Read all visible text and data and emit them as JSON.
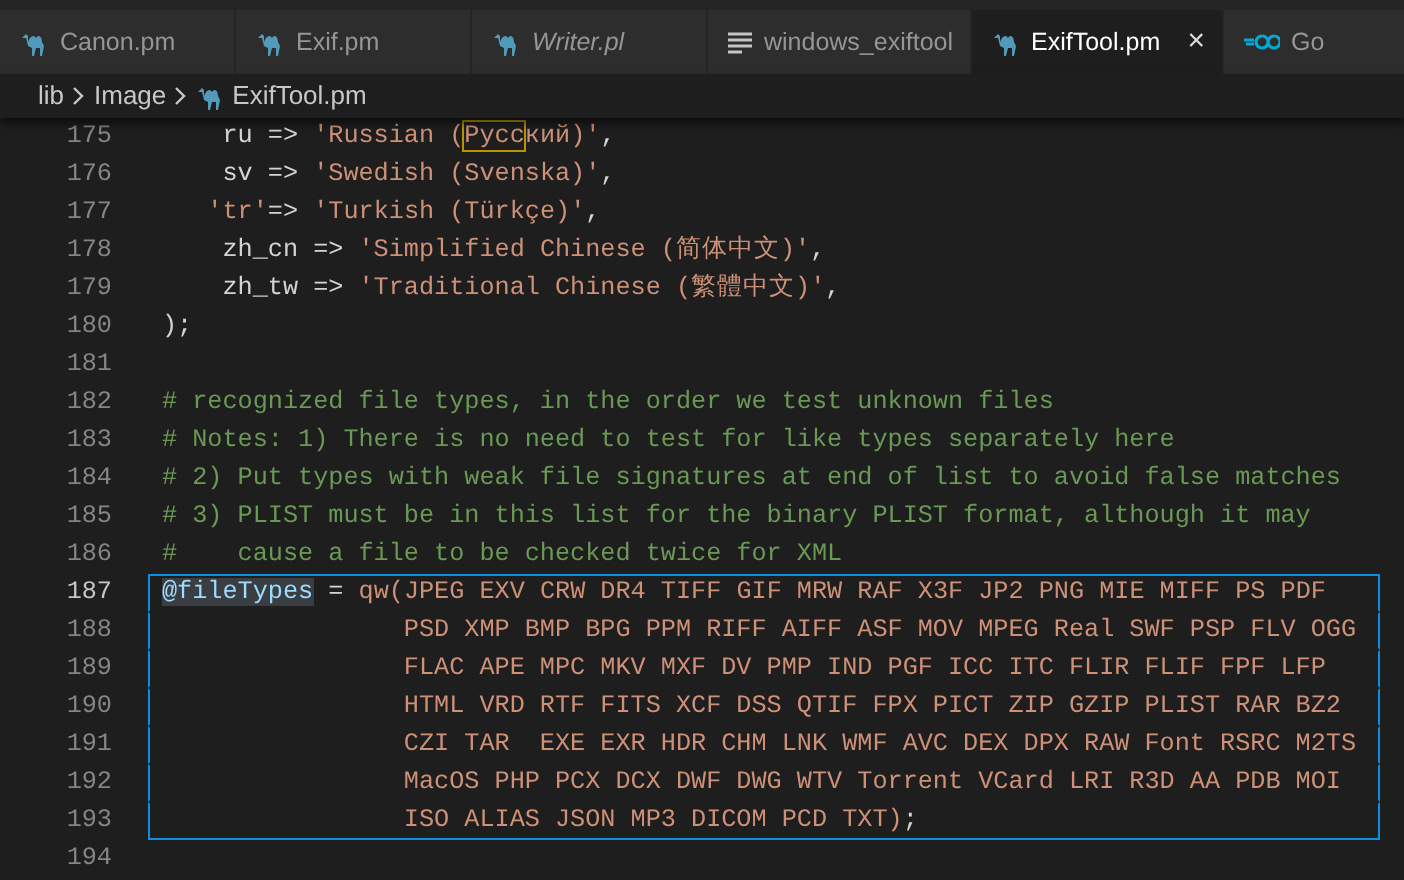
{
  "tabs": [
    {
      "label": "Canon.pm",
      "kind": "perl",
      "selected": false,
      "preview": false
    },
    {
      "label": "Exif.pm",
      "kind": "perl",
      "selected": false,
      "preview": false
    },
    {
      "label": "Writer.pl",
      "kind": "perl",
      "selected": false,
      "preview": true
    },
    {
      "label": "windows_exiftool",
      "kind": "text",
      "selected": false,
      "preview": false
    },
    {
      "label": "ExifTool.pm",
      "kind": "perl",
      "selected": true,
      "preview": false,
      "close": "×"
    },
    {
      "label": "Go",
      "kind": "go",
      "selected": false,
      "preview": false
    }
  ],
  "breadcrumb": [
    {
      "label": "lib",
      "kind": "folder"
    },
    {
      "label": "Image",
      "kind": "folder"
    },
    {
      "label": "ExifTool.pm",
      "kind": "perl"
    }
  ],
  "lines": [
    {
      "number": "175",
      "current": false,
      "boxed": false,
      "tokens": [
        {
          "kind": "plain",
          "text": "    ru => "
        },
        {
          "kind": "string",
          "text": "'Russian ("
        },
        {
          "kind": "flagged",
          "text": "Русс"
        },
        {
          "kind": "string",
          "text": "кий)'"
        },
        {
          "kind": "plain",
          "text": ","
        }
      ]
    },
    {
      "number": "176",
      "current": false,
      "boxed": false,
      "tokens": [
        {
          "kind": "plain",
          "text": "    sv => "
        },
        {
          "kind": "string",
          "text": "'Swedish (Svenska)'"
        },
        {
          "kind": "plain",
          "text": ","
        }
      ]
    },
    {
      "number": "177",
      "current": false,
      "boxed": false,
      "tokens": [
        {
          "kind": "string",
          "text": "   'tr'"
        },
        {
          "kind": "plain",
          "text": "=> "
        },
        {
          "kind": "string",
          "text": "'Turkish (Türkçe)'"
        },
        {
          "kind": "plain",
          "text": ","
        }
      ]
    },
    {
      "number": "178",
      "current": false,
      "boxed": false,
      "tokens": [
        {
          "kind": "plain",
          "text": "    zh_cn => "
        },
        {
          "kind": "string",
          "text": "'Simplified Chinese (简体中文)'"
        },
        {
          "kind": "plain",
          "text": ","
        }
      ]
    },
    {
      "number": "179",
      "current": false,
      "boxed": false,
      "tokens": [
        {
          "kind": "plain",
          "text": "    zh_tw => "
        },
        {
          "kind": "string",
          "text": "'Traditional Chinese (繁體中文)'"
        },
        {
          "kind": "plain",
          "text": ","
        }
      ]
    },
    {
      "number": "180",
      "current": false,
      "boxed": false,
      "tokens": [
        {
          "kind": "plain",
          "text": ");"
        }
      ]
    },
    {
      "number": "181",
      "current": false,
      "boxed": false
    },
    {
      "number": "182",
      "current": false,
      "boxed": false,
      "tokens": [
        {
          "kind": "comment",
          "text": "# recognized file types, in the order we test unknown files"
        }
      ]
    },
    {
      "number": "183",
      "current": false,
      "boxed": false,
      "tokens": [
        {
          "kind": "comment",
          "text": "# Notes: 1) There is no need to test for like types separately here"
        }
      ]
    },
    {
      "number": "184",
      "current": false,
      "boxed": false,
      "tokens": [
        {
          "kind": "comment",
          "text": "# 2) Put types with weak file signatures at end of list to avoid false matches"
        }
      ]
    },
    {
      "number": "185",
      "current": false,
      "boxed": false,
      "tokens": [
        {
          "kind": "comment",
          "text": "# 3) PLIST must be in this list for the binary PLIST format, although it may"
        }
      ]
    },
    {
      "number": "186",
      "current": false,
      "boxed": false,
      "tokens": [
        {
          "kind": "comment",
          "text": "#    cause a file to be checked twice for XML"
        }
      ]
    },
    {
      "number": "187",
      "current": true,
      "boxed": true,
      "tokens": [
        {
          "kind": "variable",
          "text": "@fileTypes"
        },
        {
          "kind": "plain",
          "text": " = "
        },
        {
          "kind": "string",
          "text": "qw(JPEG EXV CRW DR4 TIFF GIF MRW RAF X3F JP2 PNG MIE MIFF PS PDF"
        }
      ]
    },
    {
      "number": "188",
      "current": false,
      "boxed": true,
      "tokens": [
        {
          "kind": "string",
          "text": "                PSD XMP BMP BPG PPM RIFF AIFF ASF MOV MPEG Real SWF PSP FLV OGG"
        }
      ]
    },
    {
      "number": "189",
      "current": false,
      "boxed": true,
      "tokens": [
        {
          "kind": "string",
          "text": "                FLAC APE MPC MKV MXF DV PMP IND PGF ICC ITC FLIR FLIF FPF LFP"
        }
      ]
    },
    {
      "number": "190",
      "current": false,
      "boxed": true,
      "tokens": [
        {
          "kind": "string",
          "text": "                HTML VRD RTF FITS XCF DSS QTIF FPX PICT ZIP GZIP PLIST RAR BZ2"
        }
      ]
    },
    {
      "number": "191",
      "current": false,
      "boxed": true,
      "tokens": [
        {
          "kind": "string",
          "text": "                CZI TAR  EXE EXR HDR CHM LNK WMF AVC DEX DPX RAW Font RSRC M2TS"
        }
      ]
    },
    {
      "number": "192",
      "current": false,
      "boxed": true,
      "tokens": [
        {
          "kind": "string",
          "text": "                MacOS PHP PCX DCX DWF DWG WTV Torrent VCard LRI R3D AA PDB MOI"
        }
      ]
    },
    {
      "number": "193",
      "current": false,
      "boxed": true,
      "tokens": [
        {
          "kind": "string",
          "text": "                ISO ALIAS JSON MP3 DICOM PCD TXT)"
        },
        {
          "kind": "plain",
          "text": ";"
        }
      ]
    },
    {
      "number": "194",
      "current": false,
      "boxed": false
    }
  ]
}
